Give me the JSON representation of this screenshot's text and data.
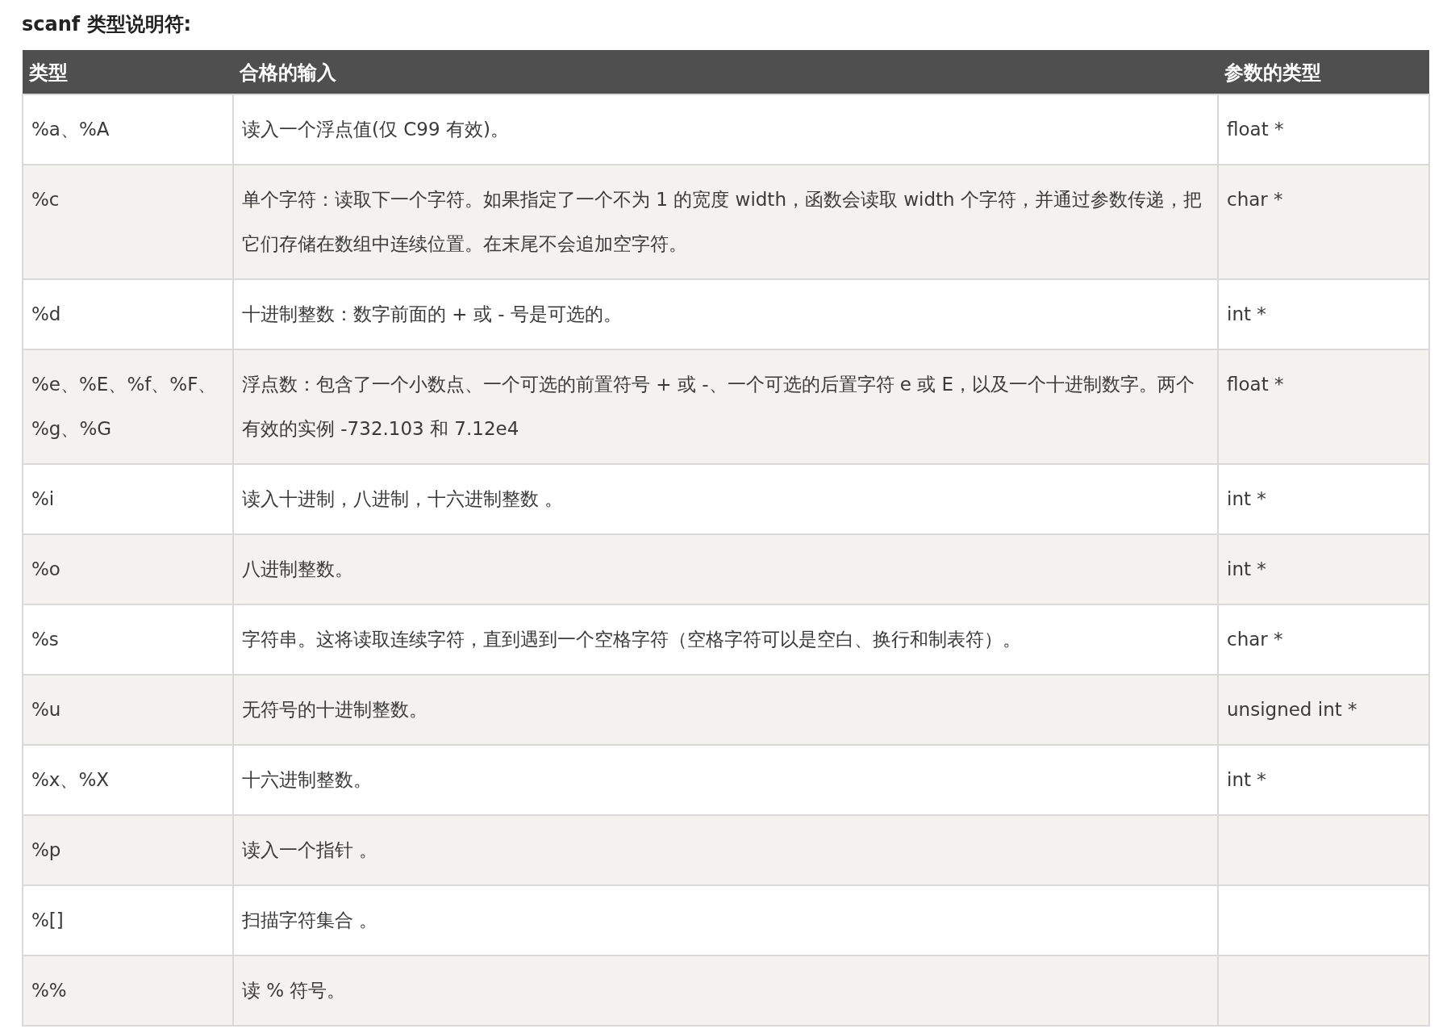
{
  "title": "scanf 类型说明符:",
  "table": {
    "columns": [
      "类型",
      "合格的输入",
      "参数的类型"
    ],
    "rows": [
      {
        "type": "%a、%A",
        "input": "读入一个浮点值(仅 C99 有效)。",
        "arg_type": "float *"
      },
      {
        "type": "%c",
        "input": "单个字符：读取下一个字符。如果指定了一个不为 1 的宽度 width，函数会读取 width 个字符，并通过参数传递，把它们存储在数组中连续位置。在末尾不会追加空字符。",
        "arg_type": "char *"
      },
      {
        "type": "%d",
        "input": "十进制整数：数字前面的 + 或 - 号是可选的。",
        "arg_type": "int *"
      },
      {
        "type": "%e、%E、%f、%F、%g、%G",
        "input": "浮点数：包含了一个小数点、一个可选的前置符号 + 或 -、一个可选的后置字符 e 或 E，以及一个十进制数字。两个有效的实例 -732.103 和 7.12e4",
        "arg_type": "float *"
      },
      {
        "type": "%i",
        "input": "读入十进制，八进制，十六进制整数 。",
        "arg_type": "int *"
      },
      {
        "type": "%o",
        "input": "八进制整数。",
        "arg_type": "int *"
      },
      {
        "type": "%s",
        "input": "字符串。这将读取连续字符，直到遇到一个空格字符（空格字符可以是空白、换行和制表符）。",
        "arg_type": "char *"
      },
      {
        "type": "%u",
        "input": "无符号的十进制整数。",
        "arg_type": "unsigned int *"
      },
      {
        "type": "%x、%X",
        "input": "十六进制整数。",
        "arg_type": "int *"
      },
      {
        "type": "%p",
        "input": "读入一个指针 。"
      },
      {
        "type": "%[]",
        "input": "扫描字符集合 。"
      },
      {
        "type": "%%",
        "input": "读 % 符号。"
      }
    ]
  }
}
